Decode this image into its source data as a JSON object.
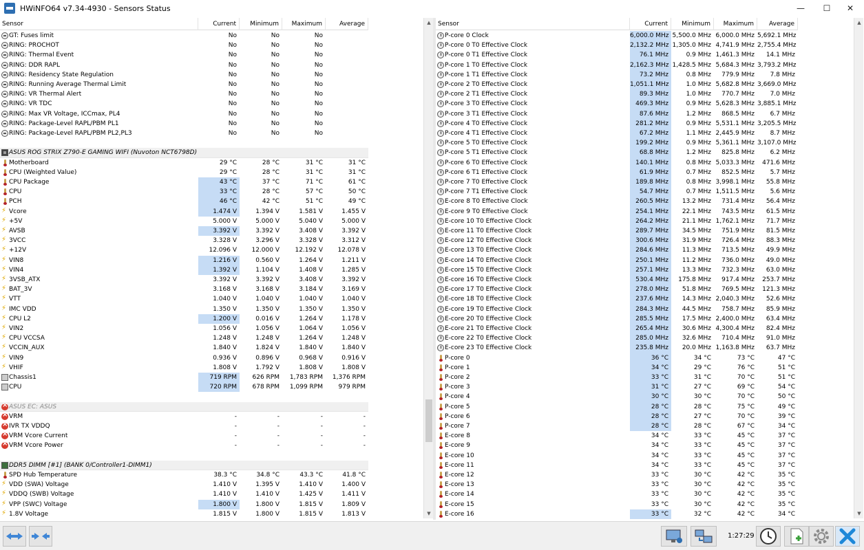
{
  "window": {
    "title": "HWiNFO64 v7.34-4930 - Sensors Status",
    "min_glyph": "—",
    "max_glyph": "☐",
    "close_glyph": "✕"
  },
  "columns": {
    "sensor": "Sensor",
    "current": "Current",
    "minimum": "Minimum",
    "maximum": "Maximum",
    "average": "Average"
  },
  "left_rows": [
    {
      "icon": "gauge",
      "name": "GT: Fuses limit",
      "cur": "No",
      "min": "No",
      "max": "No",
      "avg": ""
    },
    {
      "icon": "gauge",
      "name": "RING: PROCHOT",
      "cur": "No",
      "min": "No",
      "max": "No",
      "avg": ""
    },
    {
      "icon": "gauge",
      "name": "RING: Thermal Event",
      "cur": "No",
      "min": "No",
      "max": "No",
      "avg": ""
    },
    {
      "icon": "gauge",
      "name": "RING: DDR RAPL",
      "cur": "No",
      "min": "No",
      "max": "No",
      "avg": ""
    },
    {
      "icon": "gauge",
      "name": "RING: Residency State Regulation",
      "cur": "No",
      "min": "No",
      "max": "No",
      "avg": ""
    },
    {
      "icon": "gauge",
      "name": "RING: Running Average Thermal Limit",
      "cur": "No",
      "min": "No",
      "max": "No",
      "avg": ""
    },
    {
      "icon": "gauge",
      "name": "RING: VR Thermal Alert",
      "cur": "No",
      "min": "No",
      "max": "No",
      "avg": ""
    },
    {
      "icon": "gauge",
      "name": "RING: VR TDC",
      "cur": "No",
      "min": "No",
      "max": "No",
      "avg": ""
    },
    {
      "icon": "gauge",
      "name": "RING: Max VR Voltage, ICCmax, PL4",
      "cur": "No",
      "min": "No",
      "max": "No",
      "avg": ""
    },
    {
      "icon": "gauge",
      "name": "RING: Package-Level RAPL/PBM PL1",
      "cur": "No",
      "min": "No",
      "max": "No",
      "avg": ""
    },
    {
      "icon": "gauge",
      "name": "RING: Package-Level RAPL/PBM PL2,PL3",
      "cur": "No",
      "min": "No",
      "max": "No",
      "avg": ""
    },
    {
      "type": "blank"
    },
    {
      "type": "group",
      "icon": "chip",
      "name": "ASUS ROG STRIX Z790-E GAMING WIFI (Nuvoton NCT6798D)"
    },
    {
      "icon": "temp",
      "name": "Motherboard",
      "cur": "29 °C",
      "min": "28 °C",
      "max": "31 °C",
      "avg": "31 °C"
    },
    {
      "icon": "temp",
      "name": "CPU (Weighted Value)",
      "cur": "29 °C",
      "min": "28 °C",
      "max": "31 °C",
      "avg": "31 °C"
    },
    {
      "icon": "temp",
      "name": "CPU Package",
      "cur": "43 °C",
      "min": "37 °C",
      "max": "71 °C",
      "avg": "61 °C",
      "hl": true
    },
    {
      "icon": "temp",
      "name": "CPU",
      "cur": "33 °C",
      "min": "28 °C",
      "max": "57 °C",
      "avg": "50 °C",
      "hl": true
    },
    {
      "icon": "temp",
      "name": "PCH",
      "cur": "46 °C",
      "min": "42 °C",
      "max": "51 °C",
      "avg": "49 °C",
      "hl": true
    },
    {
      "icon": "volt",
      "name": "Vcore",
      "cur": "1.474 V",
      "min": "1.394 V",
      "max": "1.581 V",
      "avg": "1.455 V",
      "hl": true
    },
    {
      "icon": "volt",
      "name": "+5V",
      "cur": "5.000 V",
      "min": "5.000 V",
      "max": "5.040 V",
      "avg": "5.000 V"
    },
    {
      "icon": "volt",
      "name": "AVSB",
      "cur": "3.392 V",
      "min": "3.392 V",
      "max": "3.408 V",
      "avg": "3.392 V",
      "hl": true
    },
    {
      "icon": "volt",
      "name": "3VCC",
      "cur": "3.328 V",
      "min": "3.296 V",
      "max": "3.328 V",
      "avg": "3.312 V"
    },
    {
      "icon": "volt",
      "name": "+12V",
      "cur": "12.096 V",
      "min": "12.000 V",
      "max": "12.192 V",
      "avg": "12.078 V"
    },
    {
      "icon": "volt",
      "name": "VIN8",
      "cur": "1.216 V",
      "min": "0.560 V",
      "max": "1.264 V",
      "avg": "1.211 V",
      "hl": true
    },
    {
      "icon": "volt",
      "name": "VIN4",
      "cur": "1.392 V",
      "min": "1.104 V",
      "max": "1.408 V",
      "avg": "1.285 V",
      "hl": true
    },
    {
      "icon": "volt",
      "name": "3VSB_ATX",
      "cur": "3.392 V",
      "min": "3.392 V",
      "max": "3.408 V",
      "avg": "3.392 V"
    },
    {
      "icon": "volt",
      "name": "BAT_3V",
      "cur": "3.168 V",
      "min": "3.168 V",
      "max": "3.184 V",
      "avg": "3.169 V"
    },
    {
      "icon": "volt",
      "name": "VTT",
      "cur": "1.040 V",
      "min": "1.040 V",
      "max": "1.040 V",
      "avg": "1.040 V"
    },
    {
      "icon": "volt",
      "name": "IMC VDD",
      "cur": "1.350 V",
      "min": "1.350 V",
      "max": "1.350 V",
      "avg": "1.350 V"
    },
    {
      "icon": "volt",
      "name": "CPU L2",
      "cur": "1.200 V",
      "min": "0.016 V",
      "max": "1.264 V",
      "avg": "1.178 V",
      "hl": true
    },
    {
      "icon": "volt",
      "name": "VIN2",
      "cur": "1.056 V",
      "min": "1.056 V",
      "max": "1.064 V",
      "avg": "1.056 V"
    },
    {
      "icon": "volt",
      "name": "CPU VCCSA",
      "cur": "1.248 V",
      "min": "1.248 V",
      "max": "1.264 V",
      "avg": "1.248 V"
    },
    {
      "icon": "volt",
      "name": "VCCIN_AUX",
      "cur": "1.840 V",
      "min": "1.824 V",
      "max": "1.840 V",
      "avg": "1.840 V"
    },
    {
      "icon": "volt",
      "name": "VIN9",
      "cur": "0.936 V",
      "min": "0.896 V",
      "max": "0.968 V",
      "avg": "0.916 V"
    },
    {
      "icon": "volt",
      "name": "VHIF",
      "cur": "1.808 V",
      "min": "1.792 V",
      "max": "1.808 V",
      "avg": "1.808 V"
    },
    {
      "icon": "fan",
      "name": "Chassis1",
      "cur": "719 RPM",
      "min": "626 RPM",
      "max": "1,783 RPM",
      "avg": "1,376 RPM",
      "hl": true
    },
    {
      "icon": "fan",
      "name": "CPU",
      "cur": "720 RPM",
      "min": "678 RPM",
      "max": "1,099 RPM",
      "avg": "979 RPM",
      "hl": true
    },
    {
      "type": "blank"
    },
    {
      "type": "group",
      "icon": "err",
      "name": "ASUS EC: ASUS",
      "dim": true
    },
    {
      "icon": "err",
      "name": "VRM",
      "cur": "-",
      "min": "-",
      "max": "-",
      "avg": "-"
    },
    {
      "icon": "err",
      "name": "IVR TX VDDQ",
      "cur": "-",
      "min": "-",
      "max": "-",
      "avg": "-"
    },
    {
      "icon": "err",
      "name": "VRM Vcore Current",
      "cur": "-",
      "min": "-",
      "max": "-",
      "avg": "-"
    },
    {
      "icon": "err",
      "name": "VRM Vcore Power",
      "cur": "-",
      "min": "-",
      "max": "-",
      "avg": "-"
    },
    {
      "type": "blank"
    },
    {
      "type": "group",
      "icon": "ram",
      "name": "DDR5 DIMM [#1] (BANK 0/Controller1-DIMM1)"
    },
    {
      "icon": "temp",
      "name": "SPD Hub Temperature",
      "cur": "38.3 °C",
      "min": "34.8 °C",
      "max": "43.3 °C",
      "avg": "41.8 °C"
    },
    {
      "icon": "volt",
      "name": "VDD (SWA) Voltage",
      "cur": "1.410 V",
      "min": "1.395 V",
      "max": "1.410 V",
      "avg": "1.400 V"
    },
    {
      "icon": "volt",
      "name": "VDDQ (SWB) Voltage",
      "cur": "1.410 V",
      "min": "1.410 V",
      "max": "1.425 V",
      "avg": "1.411 V"
    },
    {
      "icon": "volt",
      "name": "VPP (SWC) Voltage",
      "cur": "1.800 V",
      "min": "1.800 V",
      "max": "1.815 V",
      "avg": "1.809 V",
      "hl": true
    },
    {
      "icon": "volt",
      "name": "1.8V Voltage",
      "cur": "1.815 V",
      "min": "1.800 V",
      "max": "1.815 V",
      "avg": "1.813 V"
    }
  ],
  "right_rows": [
    {
      "icon": "clock",
      "name": "P-core 0 Clock",
      "cur": "6,000.0 MHz",
      "min": "5,500.0 MHz",
      "max": "6,000.0 MHz",
      "avg": "5,692.1 MHz",
      "hl": true
    },
    {
      "icon": "clock",
      "name": "P-core 0 T0 Effective Clock",
      "cur": "2,132.2 MHz",
      "min": "1,305.0 MHz",
      "max": "4,741.9 MHz",
      "avg": "2,755.4 MHz",
      "hl": true
    },
    {
      "icon": "clock",
      "name": "P-core 0 T1 Effective Clock",
      "cur": "76.1 MHz",
      "min": "0.9 MHz",
      "max": "1,461.3 MHz",
      "avg": "14.1 MHz",
      "hl": true
    },
    {
      "icon": "clock",
      "name": "P-core 1 T0 Effective Clock",
      "cur": "2,162.3 MHz",
      "min": "1,428.5 MHz",
      "max": "5,684.3 MHz",
      "avg": "3,793.2 MHz",
      "hl": true
    },
    {
      "icon": "clock",
      "name": "P-core 1 T1 Effective Clock",
      "cur": "73.2 MHz",
      "min": "0.8 MHz",
      "max": "779.9 MHz",
      "avg": "7.8 MHz",
      "hl": true
    },
    {
      "icon": "clock",
      "name": "P-core 2 T0 Effective Clock",
      "cur": "1,051.1 MHz",
      "min": "1.0 MHz",
      "max": "5,682.8 MHz",
      "avg": "3,669.0 MHz",
      "hl": true
    },
    {
      "icon": "clock",
      "name": "P-core 2 T1 Effective Clock",
      "cur": "89.3 MHz",
      "min": "1.0 MHz",
      "max": "770.7 MHz",
      "avg": "7.0 MHz",
      "hl": true
    },
    {
      "icon": "clock",
      "name": "P-core 3 T0 Effective Clock",
      "cur": "469.3 MHz",
      "min": "0.9 MHz",
      "max": "5,628.3 MHz",
      "avg": "3,885.1 MHz",
      "hl": true
    },
    {
      "icon": "clock",
      "name": "P-core 3 T1 Effective Clock",
      "cur": "87.6 MHz",
      "min": "1.2 MHz",
      "max": "868.5 MHz",
      "avg": "6.7 MHz",
      "hl": true
    },
    {
      "icon": "clock",
      "name": "P-core 4 T0 Effective Clock",
      "cur": "281.2 MHz",
      "min": "0.9 MHz",
      "max": "5,531.1 MHz",
      "avg": "3,205.5 MHz",
      "hl": true
    },
    {
      "icon": "clock",
      "name": "P-core 4 T1 Effective Clock",
      "cur": "67.2 MHz",
      "min": "1.1 MHz",
      "max": "2,445.9 MHz",
      "avg": "8.7 MHz",
      "hl": true
    },
    {
      "icon": "clock",
      "name": "P-core 5 T0 Effective Clock",
      "cur": "199.2 MHz",
      "min": "0.9 MHz",
      "max": "5,361.1 MHz",
      "avg": "3,107.0 MHz",
      "hl": true
    },
    {
      "icon": "clock",
      "name": "P-core 5 T1 Effective Clock",
      "cur": "68.8 MHz",
      "min": "1.2 MHz",
      "max": "825.8 MHz",
      "avg": "6.2 MHz",
      "hl": true
    },
    {
      "icon": "clock",
      "name": "P-core 6 T0 Effective Clock",
      "cur": "140.1 MHz",
      "min": "0.8 MHz",
      "max": "5,033.3 MHz",
      "avg": "471.6 MHz",
      "hl": true
    },
    {
      "icon": "clock",
      "name": "P-core 6 T1 Effective Clock",
      "cur": "61.9 MHz",
      "min": "0.7 MHz",
      "max": "852.5 MHz",
      "avg": "5.7 MHz",
      "hl": true
    },
    {
      "icon": "clock",
      "name": "P-core 7 T0 Effective Clock",
      "cur": "189.8 MHz",
      "min": "0.8 MHz",
      "max": "3,998.1 MHz",
      "avg": "55.8 MHz",
      "hl": true
    },
    {
      "icon": "clock",
      "name": "P-core 7 T1 Effective Clock",
      "cur": "54.7 MHz",
      "min": "0.7 MHz",
      "max": "1,511.5 MHz",
      "avg": "5.6 MHz",
      "hl": true
    },
    {
      "icon": "clock",
      "name": "E-core 8 T0 Effective Clock",
      "cur": "260.5 MHz",
      "min": "13.2 MHz",
      "max": "731.4 MHz",
      "avg": "56.4 MHz",
      "hl": true
    },
    {
      "icon": "clock",
      "name": "E-core 9 T0 Effective Clock",
      "cur": "254.1 MHz",
      "min": "22.1 MHz",
      "max": "743.5 MHz",
      "avg": "61.5 MHz",
      "hl": true
    },
    {
      "icon": "clock",
      "name": "E-core 10 T0 Effective Clock",
      "cur": "264.2 MHz",
      "min": "21.1 MHz",
      "max": "1,762.1 MHz",
      "avg": "71.7 MHz",
      "hl": true
    },
    {
      "icon": "clock",
      "name": "E-core 11 T0 Effective Clock",
      "cur": "289.7 MHz",
      "min": "34.5 MHz",
      "max": "751.9 MHz",
      "avg": "81.5 MHz",
      "hl": true
    },
    {
      "icon": "clock",
      "name": "E-core 12 T0 Effective Clock",
      "cur": "300.6 MHz",
      "min": "31.9 MHz",
      "max": "726.4 MHz",
      "avg": "88.3 MHz",
      "hl": true
    },
    {
      "icon": "clock",
      "name": "E-core 13 T0 Effective Clock",
      "cur": "284.6 MHz",
      "min": "11.3 MHz",
      "max": "713.5 MHz",
      "avg": "49.9 MHz",
      "hl": true
    },
    {
      "icon": "clock",
      "name": "E-core 14 T0 Effective Clock",
      "cur": "250.1 MHz",
      "min": "11.2 MHz",
      "max": "736.0 MHz",
      "avg": "49.0 MHz",
      "hl": true
    },
    {
      "icon": "clock",
      "name": "E-core 15 T0 Effective Clock",
      "cur": "257.1 MHz",
      "min": "13.3 MHz",
      "max": "732.3 MHz",
      "avg": "63.0 MHz",
      "hl": true
    },
    {
      "icon": "clock",
      "name": "E-core 16 T0 Effective Clock",
      "cur": "530.4 MHz",
      "min": "175.8 MHz",
      "max": "917.4 MHz",
      "avg": "253.7 MHz",
      "hl": true
    },
    {
      "icon": "clock",
      "name": "E-core 17 T0 Effective Clock",
      "cur": "278.0 MHz",
      "min": "51.8 MHz",
      "max": "769.5 MHz",
      "avg": "121.3 MHz",
      "hl": true
    },
    {
      "icon": "clock",
      "name": "E-core 18 T0 Effective Clock",
      "cur": "237.6 MHz",
      "min": "14.3 MHz",
      "max": "2,040.3 MHz",
      "avg": "52.6 MHz",
      "hl": true
    },
    {
      "icon": "clock",
      "name": "E-core 19 T0 Effective Clock",
      "cur": "284.3 MHz",
      "min": "44.5 MHz",
      "max": "758.7 MHz",
      "avg": "85.9 MHz",
      "hl": true
    },
    {
      "icon": "clock",
      "name": "E-core 20 T0 Effective Clock",
      "cur": "285.5 MHz",
      "min": "17.5 MHz",
      "max": "2,400.0 MHz",
      "avg": "63.4 MHz",
      "hl": true
    },
    {
      "icon": "clock",
      "name": "E-core 21 T0 Effective Clock",
      "cur": "265.4 MHz",
      "min": "30.6 MHz",
      "max": "4,300.4 MHz",
      "avg": "82.4 MHz",
      "hl": true
    },
    {
      "icon": "clock",
      "name": "E-core 22 T0 Effective Clock",
      "cur": "285.0 MHz",
      "min": "32.6 MHz",
      "max": "710.4 MHz",
      "avg": "91.0 MHz",
      "hl": true
    },
    {
      "icon": "clock",
      "name": "E-core 23 T0 Effective Clock",
      "cur": "235.8 MHz",
      "min": "20.0 MHz",
      "max": "1,163.8 MHz",
      "avg": "63.7 MHz",
      "hl": true
    },
    {
      "icon": "temp",
      "name": "P-core 0",
      "cur": "36 °C",
      "min": "34 °C",
      "max": "73 °C",
      "avg": "47 °C",
      "hl": true
    },
    {
      "icon": "temp",
      "name": "P-core 1",
      "cur": "34 °C",
      "min": "29 °C",
      "max": "76 °C",
      "avg": "51 °C",
      "hl": true
    },
    {
      "icon": "temp",
      "name": "P-core 2",
      "cur": "33 °C",
      "min": "31 °C",
      "max": "70 °C",
      "avg": "51 °C",
      "hl": true
    },
    {
      "icon": "temp",
      "name": "P-core 3",
      "cur": "31 °C",
      "min": "27 °C",
      "max": "69 °C",
      "avg": "54 °C",
      "hl": true
    },
    {
      "icon": "temp",
      "name": "P-core 4",
      "cur": "30 °C",
      "min": "30 °C",
      "max": "70 °C",
      "avg": "50 °C",
      "hl": true
    },
    {
      "icon": "temp",
      "name": "P-core 5",
      "cur": "28 °C",
      "min": "28 °C",
      "max": "75 °C",
      "avg": "49 °C",
      "hl": true
    },
    {
      "icon": "temp",
      "name": "P-core 6",
      "cur": "28 °C",
      "min": "27 °C",
      "max": "70 °C",
      "avg": "39 °C",
      "hl": true
    },
    {
      "icon": "temp",
      "name": "P-core 7",
      "cur": "28 °C",
      "min": "28 °C",
      "max": "67 °C",
      "avg": "34 °C",
      "hl": true
    },
    {
      "icon": "temp",
      "name": "E-core 8",
      "cur": "34 °C",
      "min": "33 °C",
      "max": "45 °C",
      "avg": "37 °C"
    },
    {
      "icon": "temp",
      "name": "E-core 9",
      "cur": "34 °C",
      "min": "33 °C",
      "max": "45 °C",
      "avg": "37 °C"
    },
    {
      "icon": "temp",
      "name": "E-core 10",
      "cur": "34 °C",
      "min": "33 °C",
      "max": "45 °C",
      "avg": "37 °C"
    },
    {
      "icon": "temp",
      "name": "E-core 11",
      "cur": "34 °C",
      "min": "33 °C",
      "max": "45 °C",
      "avg": "37 °C"
    },
    {
      "icon": "temp",
      "name": "E-core 12",
      "cur": "33 °C",
      "min": "30 °C",
      "max": "42 °C",
      "avg": "35 °C"
    },
    {
      "icon": "temp",
      "name": "E-core 13",
      "cur": "33 °C",
      "min": "30 °C",
      "max": "42 °C",
      "avg": "35 °C"
    },
    {
      "icon": "temp",
      "name": "E-core 14",
      "cur": "33 °C",
      "min": "30 °C",
      "max": "42 °C",
      "avg": "35 °C"
    },
    {
      "icon": "temp",
      "name": "E-core 15",
      "cur": "33 °C",
      "min": "30 °C",
      "max": "42 °C",
      "avg": "35 °C"
    },
    {
      "icon": "temp",
      "name": "E-core 16",
      "cur": "33 °C",
      "min": "32 °C",
      "max": "42 °C",
      "avg": "34 °C",
      "hl": true
    }
  ],
  "statusbar": {
    "timer": "1:27:29"
  },
  "colors": {
    "highlight": "#c6dcf5",
    "accent": "#2e6fb2",
    "close": "#1e88d8"
  }
}
